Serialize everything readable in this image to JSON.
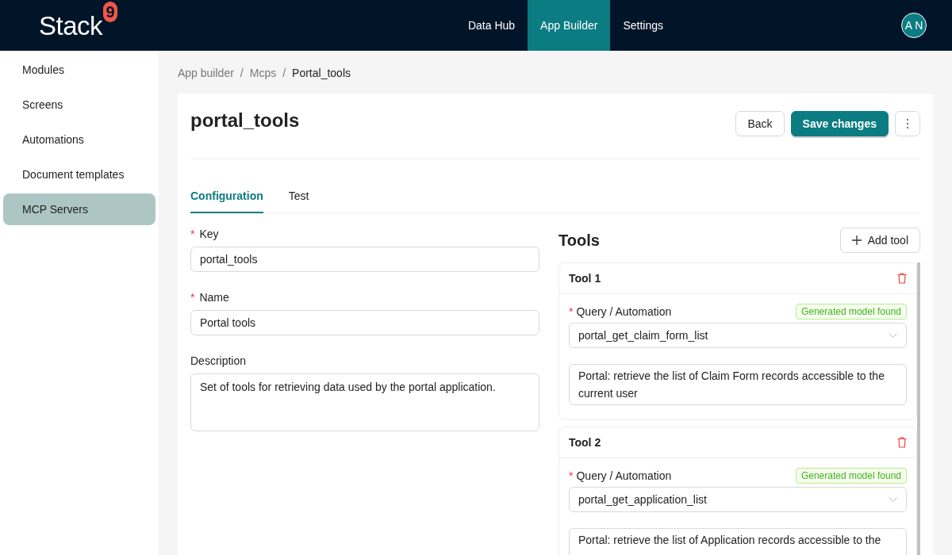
{
  "header": {
    "logo": {
      "text": "Stack",
      "mark": "9"
    },
    "nav": [
      {
        "label": "Data Hub",
        "selected": false
      },
      {
        "label": "App Builder",
        "selected": true
      },
      {
        "label": "Settings",
        "selected": false
      }
    ],
    "avatar": "A N"
  },
  "sidebar": {
    "items": [
      {
        "label": "Modules",
        "selected": false
      },
      {
        "label": "Screens",
        "selected": false
      },
      {
        "label": "Automations",
        "selected": false
      },
      {
        "label": "Document templates",
        "selected": false
      },
      {
        "label": "MCP Servers",
        "selected": true
      }
    ]
  },
  "breadcrumb": {
    "separator": "/",
    "items": [
      "App builder",
      "Mcps",
      "Portal_tools"
    ]
  },
  "page": {
    "title": "portal_tools",
    "buttons": [
      {
        "kind": "default",
        "label": "Back"
      },
      {
        "kind": "primary",
        "label": "Save changes"
      },
      {
        "kind": "more"
      }
    ]
  },
  "tabs": [
    {
      "label": "Configuration",
      "selected": true
    },
    {
      "label": "Test",
      "selected": false
    }
  ],
  "form": {
    "fields": [
      {
        "kind": "input",
        "label": "Key",
        "required_mark": "*",
        "value": "portal_tools"
      },
      {
        "kind": "input",
        "label": "Name",
        "required_mark": "*",
        "value": "Portal tools"
      },
      {
        "kind": "textarea",
        "label": "Description",
        "value": "Set of tools for retrieving data used by the portal application."
      }
    ]
  },
  "tools_panel": {
    "title": "Tools",
    "add_button": "Add tool",
    "tools": [
      {
        "title": "Tool 1",
        "query_label": "Query / Automation",
        "query_required_mark": "*",
        "tag": "Generated model found",
        "query": "portal_get_claim_form_list",
        "description": "Portal: retrieve the list of Claim Form records accessible to the current user"
      },
      {
        "title": "Tool 2",
        "query_label": "Query / Automation",
        "query_required_mark": "*",
        "tag": "Generated model found",
        "query": "portal_get_application_list",
        "description": "Portal: retrieve the list of Application records accessible to the"
      }
    ]
  }
}
